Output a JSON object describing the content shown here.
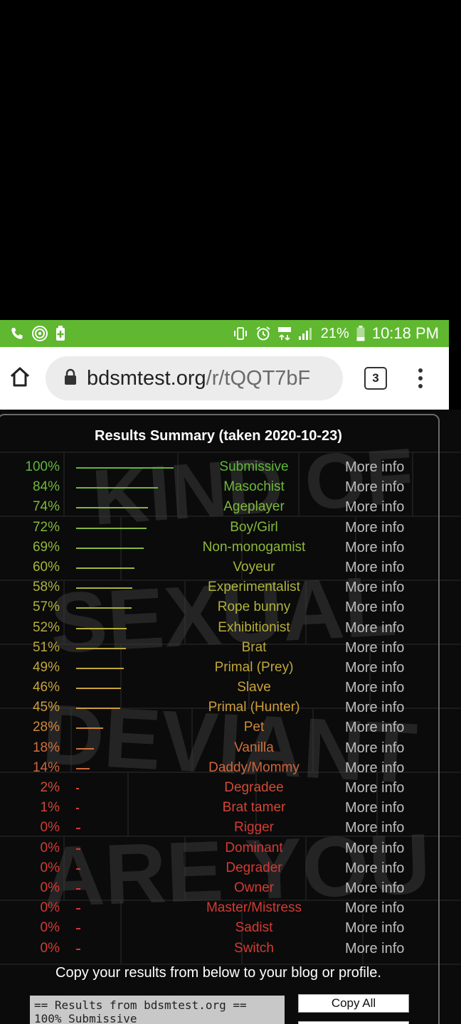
{
  "status_bar": {
    "battery_percent": "21%",
    "time": "10:18 PM",
    "network": "4G LTE"
  },
  "browser": {
    "url_host": "bdsmtest.org",
    "url_path": "/r/tQQT7bF",
    "tab_count": "3"
  },
  "summary": {
    "title": "Results Summary (taken 2020-10-23)",
    "more_label": "More info",
    "rows": [
      {
        "pct": "100%",
        "value": 100,
        "trait": "Submissive",
        "color": "#5fb83a"
      },
      {
        "pct": "84%",
        "value": 84,
        "trait": "Masochist",
        "color": "#6fb83a"
      },
      {
        "pct": "74%",
        "value": 74,
        "trait": "Ageplayer",
        "color": "#7fb83a"
      },
      {
        "pct": "72%",
        "value": 72,
        "trait": "Boy/Girl",
        "color": "#84b83a"
      },
      {
        "pct": "69%",
        "value": 69,
        "trait": "Non-monogamist",
        "color": "#8fb83a"
      },
      {
        "pct": "60%",
        "value": 60,
        "trait": "Voyeur",
        "color": "#a6b63a"
      },
      {
        "pct": "58%",
        "value": 58,
        "trait": "Experimentalist",
        "color": "#acb43a"
      },
      {
        "pct": "57%",
        "value": 57,
        "trait": "Rope bunny",
        "color": "#b0b23a"
      },
      {
        "pct": "52%",
        "value": 52,
        "trait": "Exhibitionist",
        "color": "#b8ae3a"
      },
      {
        "pct": "51%",
        "value": 51,
        "trait": "Brat",
        "color": "#baa93a"
      },
      {
        "pct": "49%",
        "value": 49,
        "trait": "Primal (Prey)",
        "color": "#c2a63a"
      },
      {
        "pct": "46%",
        "value": 46,
        "trait": "Slave",
        "color": "#c8a23a"
      },
      {
        "pct": "45%",
        "value": 45,
        "trait": "Primal (Hunter)",
        "color": "#cc9e3a"
      },
      {
        "pct": "28%",
        "value": 28,
        "trait": "Pet",
        "color": "#d0883a"
      },
      {
        "pct": "18%",
        "value": 18,
        "trait": "Vanilla",
        "color": "#d0703a"
      },
      {
        "pct": "14%",
        "value": 14,
        "trait": "Daddy/Mommy",
        "color": "#d0663a"
      },
      {
        "pct": "2%",
        "value": 2,
        "trait": "Degradee",
        "color": "#d24a36"
      },
      {
        "pct": "1%",
        "value": 1,
        "trait": "Brat tamer",
        "color": "#d24436"
      },
      {
        "pct": "0%",
        "value": 0,
        "trait": "Rigger",
        "color": "#d43a34"
      },
      {
        "pct": "0%",
        "value": 0,
        "trait": "Dominant",
        "color": "#d43a34"
      },
      {
        "pct": "0%",
        "value": 0,
        "trait": "Degrader",
        "color": "#d43a34"
      },
      {
        "pct": "0%",
        "value": 0,
        "trait": "Owner",
        "color": "#d43a34"
      },
      {
        "pct": "0%",
        "value": 0,
        "trait": "Master/Mistress",
        "color": "#d43a34"
      },
      {
        "pct": "0%",
        "value": 0,
        "trait": "Sadist",
        "color": "#d43a34"
      },
      {
        "pct": "0%",
        "value": 0,
        "trait": "Switch",
        "color": "#d43a34"
      }
    ]
  },
  "copy_section": {
    "note": "Copy your results from below to your blog or profile.",
    "results_line1": "== Results from bdsmtest.org ==",
    "results_line2": "100% Submissive",
    "copy_all_label": "Copy All"
  }
}
